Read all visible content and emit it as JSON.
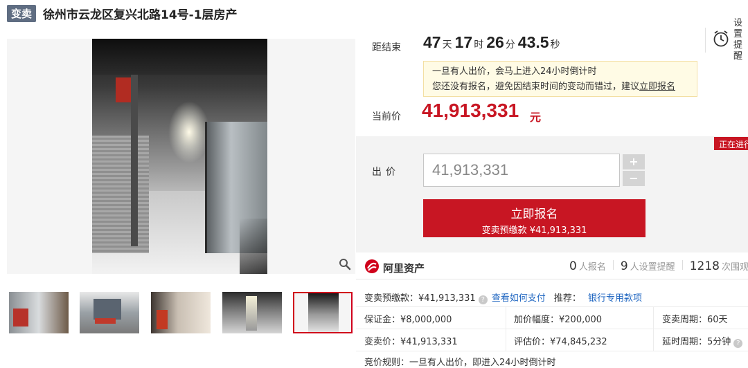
{
  "title": {
    "tag": "变卖",
    "text": "徐州市云龙区复兴北路14号-1层房产"
  },
  "countdown": {
    "label": "距结束",
    "days": "47",
    "days_unit": "天",
    "hours": "17",
    "hours_unit": "时",
    "minutes": "26",
    "minutes_unit": "分",
    "seconds": "43.5",
    "seconds_unit": "秒"
  },
  "remind": {
    "icon": "alarm-clock-icon",
    "line1": "设置",
    "line2": "提醒"
  },
  "notice": {
    "line1": "一旦有人出价，会马上进入24小时倒计时",
    "line2_prefix": "您还没有报名，避免因结束时间的变动而错过，建议",
    "line2_link": "立即报名"
  },
  "current_price": {
    "label": "当前价",
    "value": "41,913,331",
    "unit": "元"
  },
  "live_badge": "正在进行",
  "bid": {
    "label": "出价",
    "input_value": "41,913,331",
    "plus": "+",
    "minus": "−",
    "register_main": "立即报名",
    "register_sub": "变卖预缴款 ¥41,913,331"
  },
  "platform": {
    "name": "阿里资产",
    "icon": "ali-assets-logo-icon"
  },
  "stats": {
    "signed_count": "0",
    "signed_label": "人报名",
    "remind_count": "9",
    "remind_label": "人设置提醒",
    "view_count": "1218",
    "view_label": "次围观"
  },
  "info": {
    "deposit_prefix": "变卖预缴款：¥41,913,331",
    "pay_link": "查看如何支付",
    "recommend_label": "推荐：",
    "recommend_link": "银行专用款项",
    "margin": "保证金：¥8,000,000",
    "increment": "加价幅度：¥200,000",
    "period": "变卖周期：60天",
    "sale_price": "变卖价：¥41,913,331",
    "appraisal": "评估价：¥74,845,232",
    "delay": "延时周期：5分钟",
    "rule": "竞价规则：一旦有人出价，即进入24小时倒计时"
  },
  "colors": {
    "accent": "#c81623",
    "link": "#1f66c1",
    "tag_bg": "#5f6d82",
    "notice_bg": "#fffbe5"
  }
}
